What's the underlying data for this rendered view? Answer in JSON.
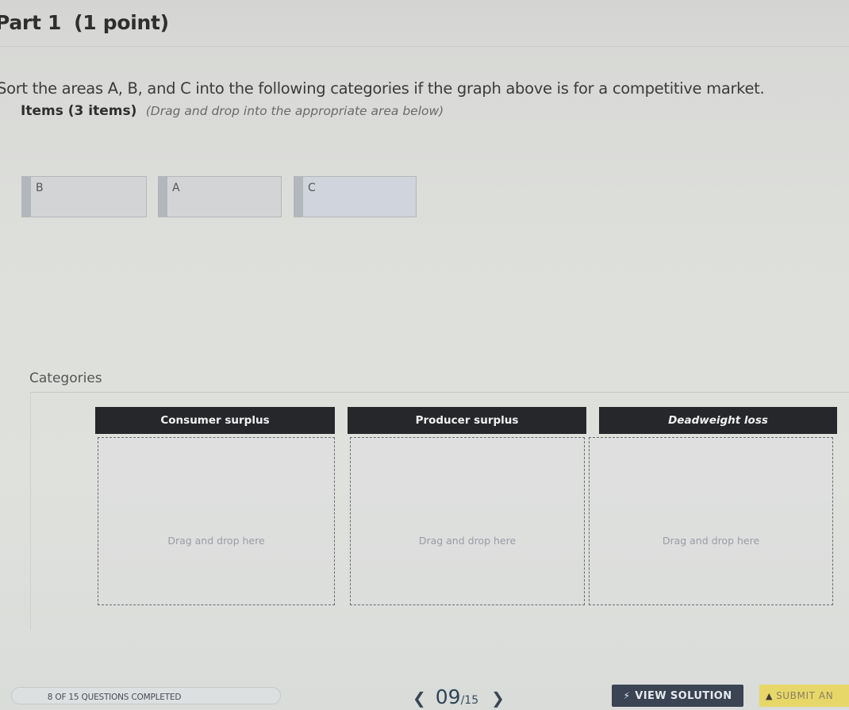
{
  "header": {
    "part": "Part 1",
    "points": "(1 point)"
  },
  "question": {
    "prompt": "Sort the areas A, B, and C into the following categories if the graph above is for a competitive market.",
    "items_title": "Items (3 items)",
    "items_hint": "(Drag and drop into the appropriate area below)"
  },
  "items": [
    {
      "label": "B"
    },
    {
      "label": "A"
    },
    {
      "label": "C"
    }
  ],
  "categories": {
    "label": "Categories",
    "columns": [
      {
        "title": "Consumer surplus",
        "drop_hint": "Drag and drop here"
      },
      {
        "title": "Producer surplus",
        "drop_hint": "Drag and drop here"
      },
      {
        "title": "Deadweight loss",
        "drop_hint": "Drag and drop here"
      }
    ]
  },
  "footer": {
    "progress_text": "8 OF 15 QUESTIONS COMPLETED",
    "progress": {
      "completed": 8,
      "total": 15
    },
    "pager": {
      "prev_icon": "chevron-left-icon",
      "current": "09",
      "total": "/15",
      "next_icon": "chevron-right-icon"
    },
    "view_solution": {
      "label": "VIEW SOLUTION",
      "icon": "lightning-icon",
      "color": "#3a4453"
    },
    "submit": {
      "label": "SUBMIT AN",
      "icon": "upload-arrow-icon",
      "color": "#e7d769"
    }
  }
}
